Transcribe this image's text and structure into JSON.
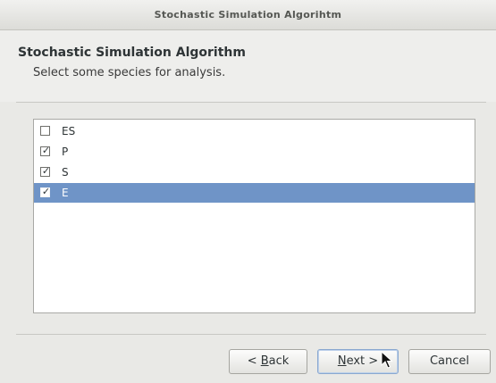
{
  "window": {
    "title": "Stochastic Simulation Algorihtm"
  },
  "header": {
    "title": "Stochastic Simulation Algorithm",
    "subtitle": "Select some species for analysis."
  },
  "species_list": [
    {
      "label": "ES",
      "checked": false,
      "selected": false
    },
    {
      "label": "P",
      "checked": true,
      "selected": false
    },
    {
      "label": "S",
      "checked": true,
      "selected": false
    },
    {
      "label": "E",
      "checked": true,
      "selected": true
    }
  ],
  "check_glyph": "✓",
  "buttons": {
    "back_prefix": "< ",
    "back_mnemonic": "B",
    "back_rest": "ack",
    "next_mnemonic": "N",
    "next_rest": "ext >",
    "cancel": "Cancel"
  },
  "colors": {
    "selection": "#6f94c7",
    "window_bg": "#e9e9e6"
  },
  "icons": {
    "checkbox": "checkbox-icon",
    "cursor": "mouse-pointer-icon"
  }
}
